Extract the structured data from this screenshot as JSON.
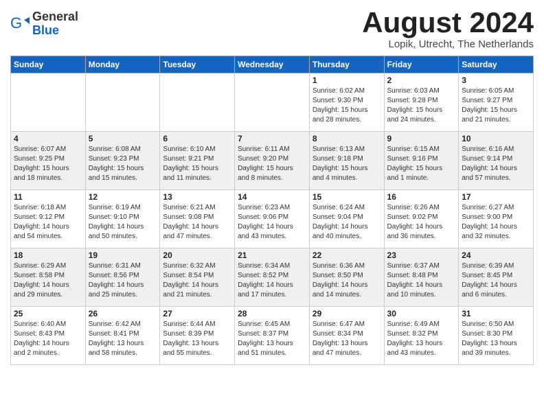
{
  "header": {
    "logo_general": "General",
    "logo_blue": "Blue",
    "month_title": "August 2024",
    "location": "Lopik, Utrecht, The Netherlands"
  },
  "days_of_week": [
    "Sunday",
    "Monday",
    "Tuesday",
    "Wednesday",
    "Thursday",
    "Friday",
    "Saturday"
  ],
  "weeks": [
    [
      {
        "day": "",
        "info": ""
      },
      {
        "day": "",
        "info": ""
      },
      {
        "day": "",
        "info": ""
      },
      {
        "day": "",
        "info": ""
      },
      {
        "day": "1",
        "info": "Sunrise: 6:02 AM\nSunset: 9:30 PM\nDaylight: 15 hours\nand 28 minutes."
      },
      {
        "day": "2",
        "info": "Sunrise: 6:03 AM\nSunset: 9:28 PM\nDaylight: 15 hours\nand 24 minutes."
      },
      {
        "day": "3",
        "info": "Sunrise: 6:05 AM\nSunset: 9:27 PM\nDaylight: 15 hours\nand 21 minutes."
      }
    ],
    [
      {
        "day": "4",
        "info": "Sunrise: 6:07 AM\nSunset: 9:25 PM\nDaylight: 15 hours\nand 18 minutes."
      },
      {
        "day": "5",
        "info": "Sunrise: 6:08 AM\nSunset: 9:23 PM\nDaylight: 15 hours\nand 15 minutes."
      },
      {
        "day": "6",
        "info": "Sunrise: 6:10 AM\nSunset: 9:21 PM\nDaylight: 15 hours\nand 11 minutes."
      },
      {
        "day": "7",
        "info": "Sunrise: 6:11 AM\nSunset: 9:20 PM\nDaylight: 15 hours\nand 8 minutes."
      },
      {
        "day": "8",
        "info": "Sunrise: 6:13 AM\nSunset: 9:18 PM\nDaylight: 15 hours\nand 4 minutes."
      },
      {
        "day": "9",
        "info": "Sunrise: 6:15 AM\nSunset: 9:16 PM\nDaylight: 15 hours\nand 1 minute."
      },
      {
        "day": "10",
        "info": "Sunrise: 6:16 AM\nSunset: 9:14 PM\nDaylight: 14 hours\nand 57 minutes."
      }
    ],
    [
      {
        "day": "11",
        "info": "Sunrise: 6:18 AM\nSunset: 9:12 PM\nDaylight: 14 hours\nand 54 minutes."
      },
      {
        "day": "12",
        "info": "Sunrise: 6:19 AM\nSunset: 9:10 PM\nDaylight: 14 hours\nand 50 minutes."
      },
      {
        "day": "13",
        "info": "Sunrise: 6:21 AM\nSunset: 9:08 PM\nDaylight: 14 hours\nand 47 minutes."
      },
      {
        "day": "14",
        "info": "Sunrise: 6:23 AM\nSunset: 9:06 PM\nDaylight: 14 hours\nand 43 minutes."
      },
      {
        "day": "15",
        "info": "Sunrise: 6:24 AM\nSunset: 9:04 PM\nDaylight: 14 hours\nand 40 minutes."
      },
      {
        "day": "16",
        "info": "Sunrise: 6:26 AM\nSunset: 9:02 PM\nDaylight: 14 hours\nand 36 minutes."
      },
      {
        "day": "17",
        "info": "Sunrise: 6:27 AM\nSunset: 9:00 PM\nDaylight: 14 hours\nand 32 minutes."
      }
    ],
    [
      {
        "day": "18",
        "info": "Sunrise: 6:29 AM\nSunset: 8:58 PM\nDaylight: 14 hours\nand 29 minutes."
      },
      {
        "day": "19",
        "info": "Sunrise: 6:31 AM\nSunset: 8:56 PM\nDaylight: 14 hours\nand 25 minutes."
      },
      {
        "day": "20",
        "info": "Sunrise: 6:32 AM\nSunset: 8:54 PM\nDaylight: 14 hours\nand 21 minutes."
      },
      {
        "day": "21",
        "info": "Sunrise: 6:34 AM\nSunset: 8:52 PM\nDaylight: 14 hours\nand 17 minutes."
      },
      {
        "day": "22",
        "info": "Sunrise: 6:36 AM\nSunset: 8:50 PM\nDaylight: 14 hours\nand 14 minutes."
      },
      {
        "day": "23",
        "info": "Sunrise: 6:37 AM\nSunset: 8:48 PM\nDaylight: 14 hours\nand 10 minutes."
      },
      {
        "day": "24",
        "info": "Sunrise: 6:39 AM\nSunset: 8:45 PM\nDaylight: 14 hours\nand 6 minutes."
      }
    ],
    [
      {
        "day": "25",
        "info": "Sunrise: 6:40 AM\nSunset: 8:43 PM\nDaylight: 14 hours\nand 2 minutes."
      },
      {
        "day": "26",
        "info": "Sunrise: 6:42 AM\nSunset: 8:41 PM\nDaylight: 13 hours\nand 58 minutes."
      },
      {
        "day": "27",
        "info": "Sunrise: 6:44 AM\nSunset: 8:39 PM\nDaylight: 13 hours\nand 55 minutes."
      },
      {
        "day": "28",
        "info": "Sunrise: 6:45 AM\nSunset: 8:37 PM\nDaylight: 13 hours\nand 51 minutes."
      },
      {
        "day": "29",
        "info": "Sunrise: 6:47 AM\nSunset: 8:34 PM\nDaylight: 13 hours\nand 47 minutes."
      },
      {
        "day": "30",
        "info": "Sunrise: 6:49 AM\nSunset: 8:32 PM\nDaylight: 13 hours\nand 43 minutes."
      },
      {
        "day": "31",
        "info": "Sunrise: 6:50 AM\nSunset: 8:30 PM\nDaylight: 13 hours\nand 39 minutes."
      }
    ]
  ]
}
